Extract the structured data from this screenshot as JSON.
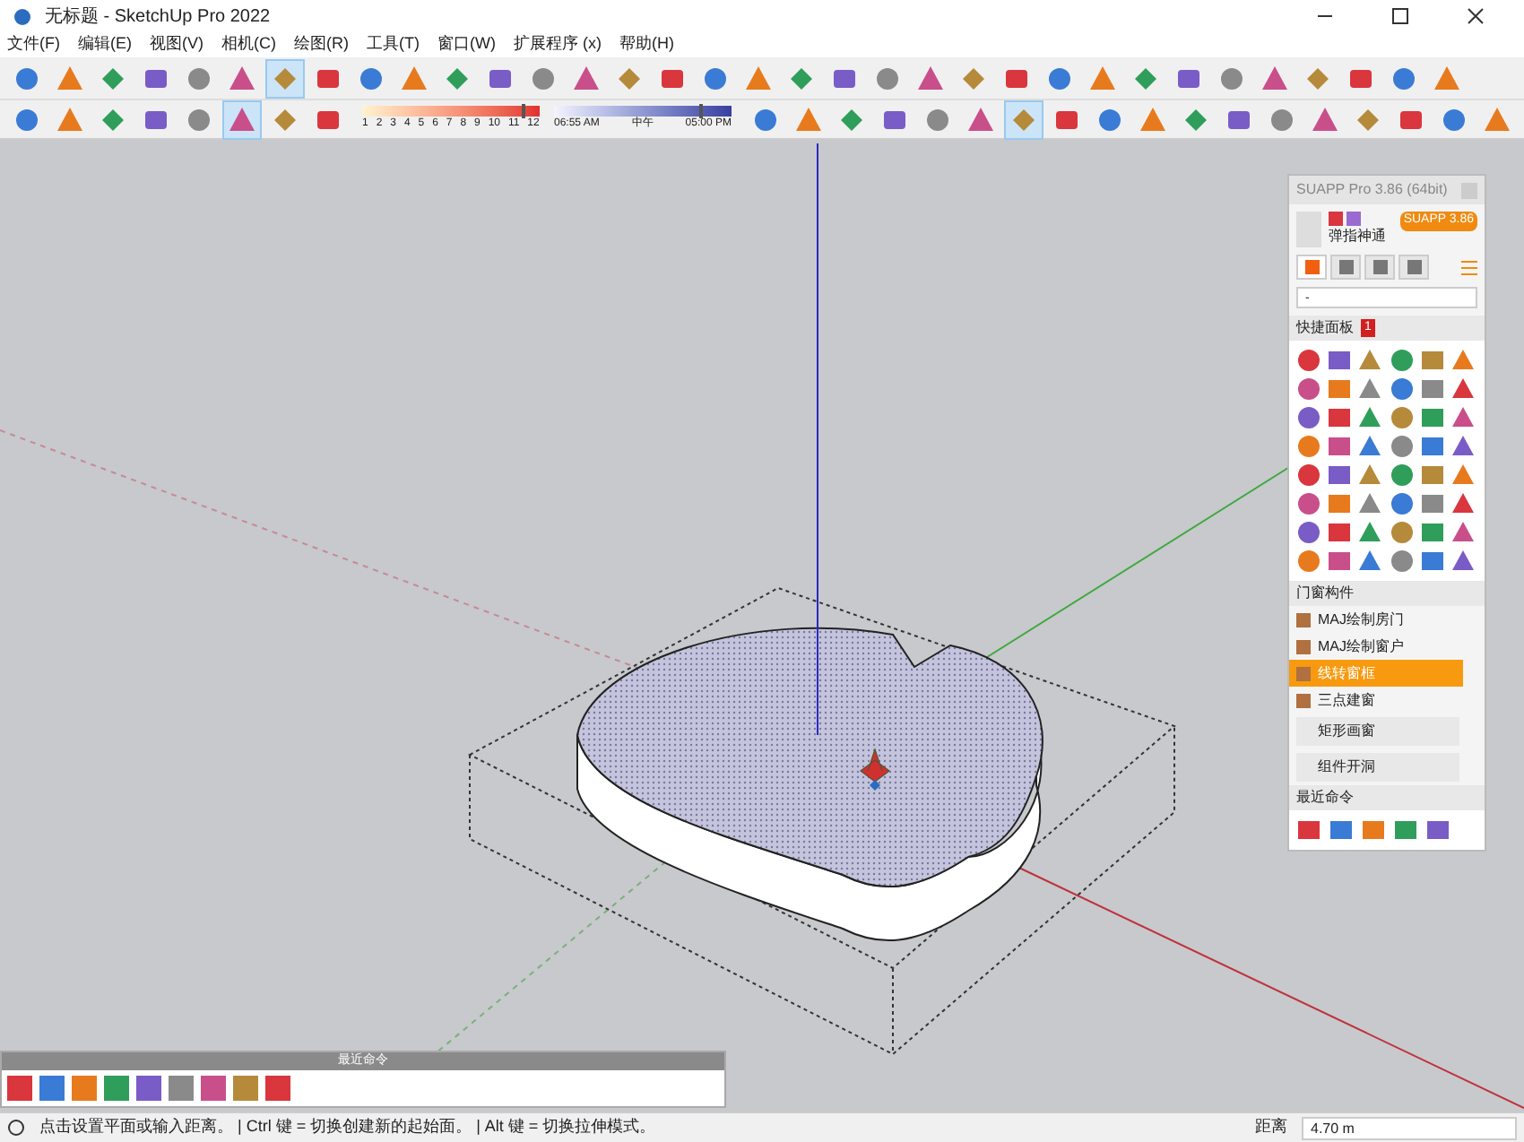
{
  "window": {
    "title": "无标题 - SketchUp Pro 2022"
  },
  "menu": [
    "文件(F)",
    "编辑(E)",
    "视图(V)",
    "相机(C)",
    "绘图(R)",
    "工具(T)",
    "窗口(W)",
    "扩展程序 (x)",
    "帮助(H)"
  ],
  "toolbar_1": [
    {
      "selected": false
    },
    {
      "selected": false
    },
    {
      "selected": false
    },
    {
      "selected": false
    },
    {
      "selected": false
    },
    {
      "selected": false
    },
    {
      "selected": true
    },
    {
      "selected": false
    },
    {
      "selected": false
    },
    {
      "selected": false
    },
    {
      "selected": false
    },
    {
      "selected": false
    },
    {
      "selected": false
    },
    {
      "selected": false
    },
    {
      "selected": false
    },
    {
      "selected": false
    },
    {
      "selected": false
    },
    {
      "selected": false
    },
    {
      "selected": false
    },
    {
      "selected": false
    },
    {
      "selected": false
    },
    {
      "selected": false
    },
    {
      "selected": false
    },
    {
      "selected": false
    },
    {
      "selected": false
    },
    {
      "selected": false
    },
    {
      "selected": false
    },
    {
      "selected": false
    },
    {
      "selected": false
    },
    {
      "selected": false
    },
    {
      "selected": false
    },
    {
      "selected": false
    },
    {
      "selected": false
    },
    {
      "selected": false
    }
  ],
  "toolbar_2": [
    {
      "selected": false
    },
    {
      "selected": false
    },
    {
      "selected": false
    },
    {
      "selected": false
    },
    {
      "selected": false
    },
    {
      "selected": true
    },
    {
      "selected": false
    },
    {
      "selected": false
    }
  ],
  "shadow_months": {
    "ticks": [
      "1",
      "2",
      "3",
      "4",
      "5",
      "6",
      "7",
      "8",
      "9",
      "10",
      "11",
      "12"
    ],
    "level": 0.9
  },
  "shadow_time": {
    "labels": [
      "06:55 AM",
      "中午",
      "05:00 PM"
    ],
    "level": 0.82
  },
  "toolbar_3": [
    {
      "selected": false
    },
    {
      "selected": false
    },
    {
      "selected": false
    },
    {
      "selected": false
    },
    {
      "selected": false
    },
    {
      "selected": false
    },
    {
      "selected": true
    },
    {
      "selected": false
    },
    {
      "selected": false
    },
    {
      "selected": false
    },
    {
      "selected": false
    },
    {
      "selected": false
    },
    {
      "selected": false
    },
    {
      "selected": false
    },
    {
      "selected": false
    },
    {
      "selected": false
    },
    {
      "selected": false
    },
    {
      "selected": false
    }
  ],
  "suapp_panel": {
    "title": "SUAPP Pro 3.86 (64bit)",
    "user_name": "弹指神通",
    "version_button": "SUAPP 3.86",
    "tabs": [
      {
        "selected": true
      },
      {
        "selected": false
      },
      {
        "selected": false
      },
      {
        "selected": false
      }
    ],
    "search": {
      "value": "-"
    },
    "quick_panel": {
      "title": "快捷面板",
      "badge": "1"
    },
    "door_window": {
      "title": "门窗构件",
      "items": [
        {
          "label": "MAJ绘制房门",
          "selected": false
        },
        {
          "label": "MAJ绘制窗户",
          "selected": false
        },
        {
          "label": "线转窗框",
          "selected": true
        },
        {
          "label": "三点建窗",
          "selected": false
        }
      ],
      "submenus": [
        "矩形画窗",
        "组件开洞"
      ]
    },
    "recent": {
      "title": "最近命令"
    }
  },
  "recent_panel": {
    "title": "最近命令"
  },
  "status_bar": {
    "hint": "点击设置平面或输入距离。 | Ctrl 键 = 切换创建新的起始面。 | Alt 键 = 切换拉伸模式。",
    "measure_label": "距离",
    "measure_value": "4.70 m"
  }
}
